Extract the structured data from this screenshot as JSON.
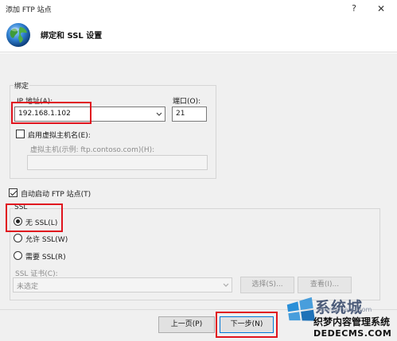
{
  "window": {
    "title": "添加 FTP 站点",
    "help_label": "?",
    "close_label": "✕"
  },
  "header": {
    "title": "绑定和 SSL 设置"
  },
  "binding": {
    "group_label": "绑定",
    "ip_label": "IP 地址(A):",
    "ip_value": "192.168.1.102",
    "port_label": "端口(O):",
    "port_value": "21",
    "virtual_host_checkbox_label": "启用虚拟主机名(E):",
    "virtual_host_checked": false,
    "virtual_host_field_label": "虚拟主机(示例: ftp.contoso.com)(H):",
    "virtual_host_value": ""
  },
  "auto_start": {
    "label": "自动启动 FTP 站点(T)",
    "checked": true
  },
  "ssl": {
    "group_label": "SSL",
    "options": [
      {
        "label": "无 SSL(L)",
        "selected": true
      },
      {
        "label": "允许 SSL(W)",
        "selected": false
      },
      {
        "label": "需要 SSL(R)",
        "selected": false
      }
    ],
    "cert_label": "SSL 证书(C):",
    "cert_value": "未选定",
    "select_button": "选择(S)...",
    "view_button": "查看(I)..."
  },
  "footer": {
    "prev_button": "上一页(P)",
    "next_button": "下一步(N)"
  },
  "watermark": {
    "big_text": "系统城",
    "faint_text": "xitongcheng.com",
    "line1": "织梦内容管理系统",
    "line2": "DEDECMS.COM"
  },
  "colors": {
    "highlight_box": "#e0141e",
    "dialog_background": "#f0f0f0"
  }
}
